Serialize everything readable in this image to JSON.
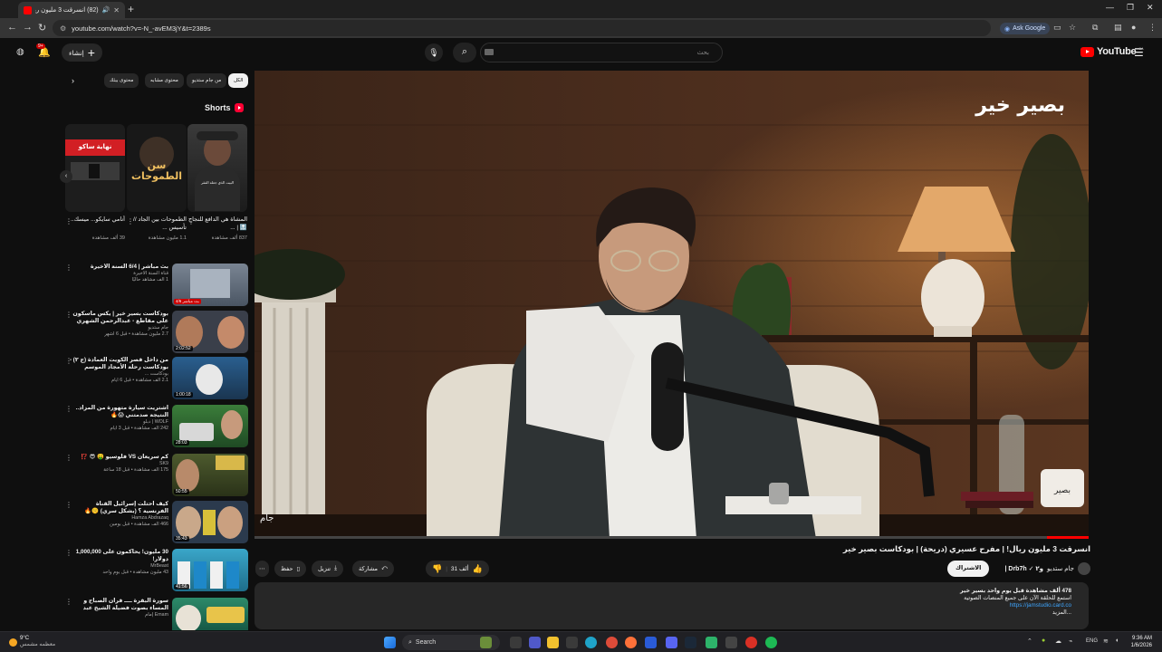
{
  "browser": {
    "tab_title": "(82) انسرقت 3 مليون ريال! |",
    "url": "youtube.com/watch?v=-N_-avEM3jY&t=2389s",
    "ask_google": "Ask Google"
  },
  "youtube": {
    "logo_text": "YouTube",
    "logo_superscript": "SA",
    "search_placeholder": "بحث",
    "create_label": "إنشاء",
    "notifications_badge": "9+"
  },
  "chips": [
    "الكل",
    "من جام ستديو",
    "محتوى مشابه",
    "محتوى ببثك"
  ],
  "shorts": {
    "heading": "Shorts",
    "items": [
      {
        "title": "المشاة هي الدافع للنجاح 🔝 | ...",
        "views": "837 ألف مشاهدة",
        "overlay": "البيت الذي جعله الفقر"
      },
      {
        "title": "الطموحات بين الجاد // تأسيس ...",
        "views": "1.1 مليون مشاهدة",
        "overlay": "سن الطموحات"
      },
      {
        "title": "أنامي سايكو... ميسك..",
        "views": "39 ألف مشاهدة",
        "overlay": "نهاية ساكو"
      }
    ]
  },
  "recommendations": [
    {
      "title": "بث مباشر | 6/4 السنة الأخيرة",
      "channel": "قناة السنة الأخيرة",
      "views": "1 ألف مشاهد حاليًا",
      "badge": "بث مباشر 4/6"
    },
    {
      "title": "بودكاست بسير خير | يكس ماسكون على مقاطع - عبدالرحمن الشهري",
      "channel": "جام ستديو",
      "views": "2.7 مليون مشاهدة • قبل 6 أشهر",
      "duration": "2:02:52"
    },
    {
      "title": "من داخل قصر الكويت العمادة (ج ٢) - بودكاست رحلة الأمجاد الموسم الثالث",
      "channel": "بودكاست ...",
      "views": "2.1 ألف مشاهدة • قبل 6 أيام",
      "duration": "1:00:18",
      "badge": "جديد"
    },
    {
      "title": "اشتريت سيارة متهورة من المزاد.. النتيجة صدمتني 😱🔥",
      "channel": "WOLF | دبلو",
      "views": "242 ألف مشاهدة • قبل 3 أيام",
      "duration": "28:03",
      "badge": "جديد"
    },
    {
      "title": "كم سريعان VS فلوسيو 🤑 😎 ⁉️",
      "channel": "SK9",
      "views": "175 ألف مشاهدة • قبل 18 ساعة",
      "duration": "50:55",
      "badge": "جديد"
    },
    {
      "title": "كيف احتلت إسرائيل القناة الفرنسية ؟ (بشكل سري) 🤫🔥",
      "channel": "Hamza Abdrazaq",
      "views": "466 ألف مشاهدة • قبل يومين",
      "duration": "35:43"
    },
    {
      "title": "30 مليون! يحاكمون على 1,000,000 دولار!",
      "channel": "MrBeast",
      "views": "43 مليون مشاهدة • قبل يوم واحد",
      "duration": "41:56"
    },
    {
      "title": "سورة البقرة ــــ قرآن الصباح و المساء بصوت فضيلة الشيخ عبد الرحمن السديس للـ...",
      "channel": "Emam إمام",
      "views": "",
      "duration": ""
    }
  ],
  "video": {
    "watermark": "بصير خير",
    "title": "انسرقت 3 مليون ريال! | مفرح عسيري (دريحة) | بودكاست بصير خير",
    "channel": "جام ستديو",
    "channel_meta": "و٢ ✓ Drb7h |",
    "join_label": "الاشتراك",
    "likes": "31 ألف",
    "share_label": "مشاركة",
    "download_label": "تنزيل",
    "save_label": "حفظ",
    "progress_percent": 5
  },
  "description": {
    "meta": "478 ألف مشاهدة  قبل يوم واحد  بسير خير",
    "line1": "استمع للحلقة الآن على جميع المنصات الصوتية",
    "link": "https://jamstudio.card.co",
    "more": "...المزيد"
  },
  "taskbar": {
    "weather_temp": "9°C",
    "weather_desc": "معظمه مشمس",
    "search_label": "Search",
    "lang": "ENG",
    "time": "9:36 AM",
    "date": "1/6/2026"
  }
}
